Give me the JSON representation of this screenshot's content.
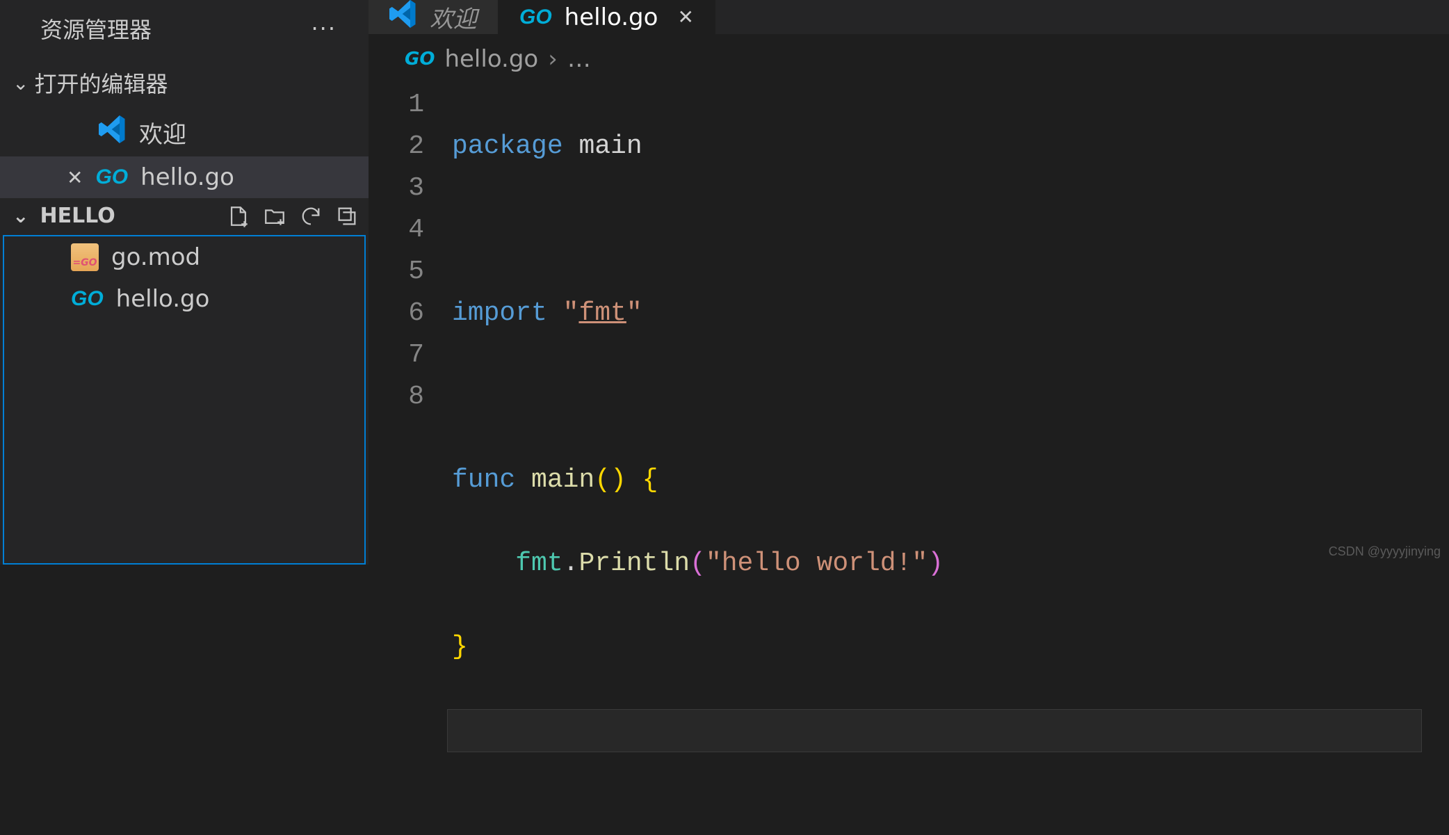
{
  "sidebar": {
    "title": "资源管理器",
    "open_editors_label": "打开的编辑器",
    "open_editors": [
      {
        "icon": "vscode-icon",
        "label": "欢迎",
        "active": false,
        "closable": false
      },
      {
        "icon": "go-icon",
        "label": "hello.go",
        "active": true,
        "closable": true
      }
    ],
    "folder_name": "HELLO",
    "files": [
      {
        "icon": "gomod-icon",
        "label": "go.mod"
      },
      {
        "icon": "go-icon",
        "label": "hello.go"
      }
    ]
  },
  "tabs": [
    {
      "icon": "vscode-icon",
      "label": "欢迎",
      "active": false,
      "italic": true,
      "closable": false
    },
    {
      "icon": "go-icon",
      "label": "hello.go",
      "active": true,
      "italic": false,
      "closable": true
    }
  ],
  "breadcrumb": {
    "file": "hello.go",
    "more": "…"
  },
  "code": {
    "lines": [
      "1",
      "2",
      "3",
      "4",
      "5",
      "6",
      "7",
      "8"
    ],
    "l1_kw": "package",
    "l1_ident": " main",
    "l3_kw": "import",
    "l3_q1": " \"",
    "l3_lib": "fmt",
    "l3_q2": "\"",
    "l5_kw": "func",
    "l5_name": " main",
    "l5_p": "()",
    "l5_b": " {",
    "l6_indent": "    ",
    "l6_obj": "fmt",
    "l6_dot": ".",
    "l6_fn": "Println",
    "l6_po": "(",
    "l6_str": "\"hello world!\"",
    "l6_pc": ")",
    "l7_b": "}"
  },
  "watermark": "CSDN @yyyyjinying"
}
